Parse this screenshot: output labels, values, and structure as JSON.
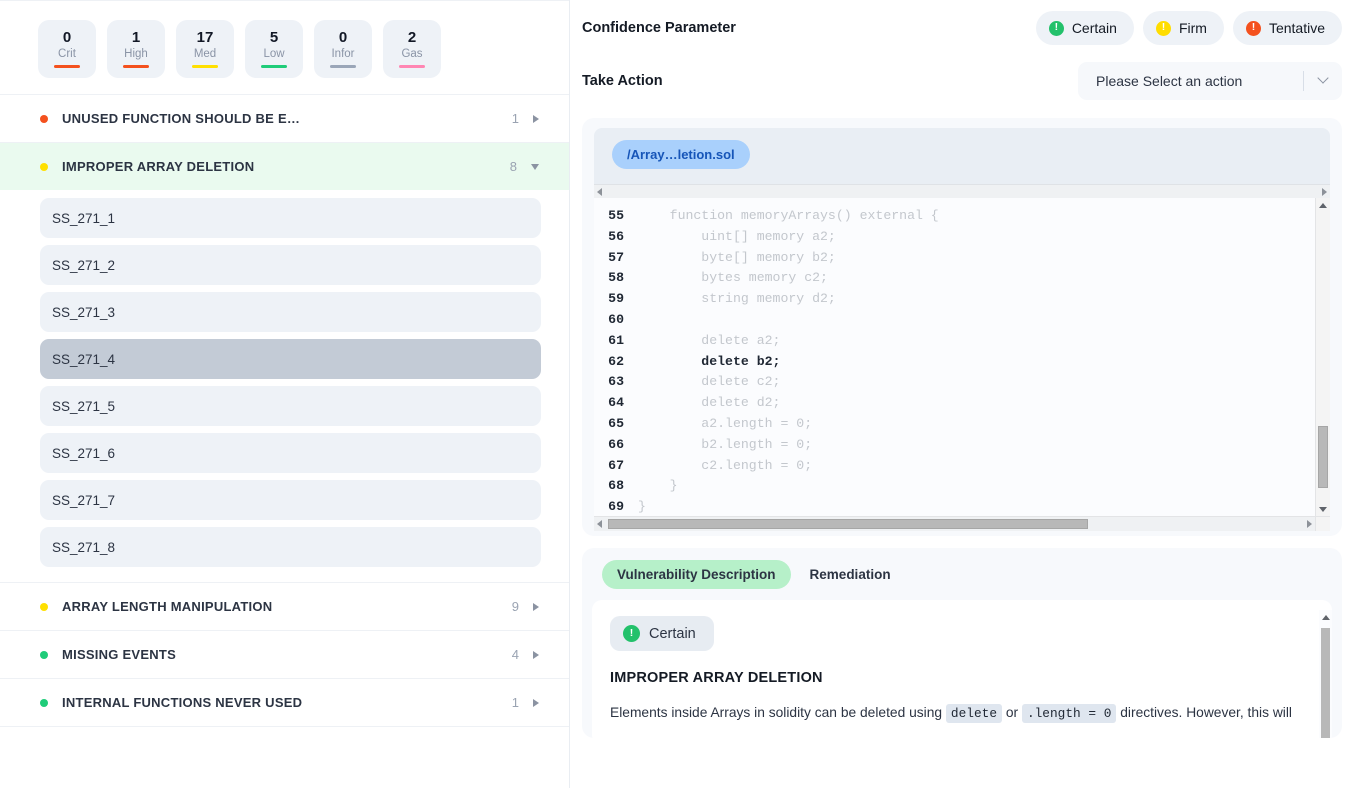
{
  "severity_cards": [
    {
      "count": "0",
      "label": "Crit",
      "color": "#f4511e"
    },
    {
      "count": "1",
      "label": "High",
      "color": "#f4511e"
    },
    {
      "count": "17",
      "label": "Med",
      "color": "#ffe000"
    },
    {
      "count": "5",
      "label": "Low",
      "color": "#1fcc79"
    },
    {
      "count": "0",
      "label": "Infor",
      "color": "#9aa6b8"
    },
    {
      "count": "2",
      "label": "Gas",
      "color": "#ff86b3"
    }
  ],
  "vuln_groups": [
    {
      "name": "UNUSED FUNCTION SHOULD BE E…",
      "count": "1",
      "dot": "#f4511e",
      "expanded": false
    },
    {
      "name": "IMPROPER ARRAY DELETION",
      "count": "8",
      "dot": "#ffe000",
      "expanded": true
    },
    {
      "name": "ARRAY LENGTH MANIPULATION",
      "count": "9",
      "dot": "#ffe000",
      "expanded": false
    },
    {
      "name": "MISSING EVENTS",
      "count": "4",
      "dot": "#1fcc79",
      "expanded": false
    },
    {
      "name": "INTERNAL FUNCTIONS NEVER USED",
      "count": "1",
      "dot": "#1fcc79",
      "expanded": false
    }
  ],
  "sub_items": [
    {
      "label": "SS_271_1",
      "selected": false
    },
    {
      "label": "SS_271_2",
      "selected": false
    },
    {
      "label": "SS_271_3",
      "selected": false
    },
    {
      "label": "SS_271_4",
      "selected": true
    },
    {
      "label": "SS_271_5",
      "selected": false
    },
    {
      "label": "SS_271_6",
      "selected": false
    },
    {
      "label": "SS_271_7",
      "selected": false
    },
    {
      "label": "SS_271_8",
      "selected": false
    }
  ],
  "confidence": {
    "label": "Confidence Parameter",
    "buttons": [
      {
        "label": "Certain",
        "color": "#23c16b"
      },
      {
        "label": "Firm",
        "color": "#ffdd00"
      },
      {
        "label": "Tentative",
        "color": "#f4511e"
      }
    ]
  },
  "take_action": {
    "label": "Take Action",
    "selected": "Please Select an action"
  },
  "code_panel": {
    "file_tab": "/Array…letion.sol",
    "lines": [
      {
        "num": "55",
        "text": "    function memoryArrays() external {",
        "highlight": false
      },
      {
        "num": "56",
        "text": "        uint[] memory a2;",
        "highlight": false
      },
      {
        "num": "57",
        "text": "        byte[] memory b2;",
        "highlight": false
      },
      {
        "num": "58",
        "text": "        bytes memory c2;",
        "highlight": false
      },
      {
        "num": "59",
        "text": "        string memory d2;",
        "highlight": false
      },
      {
        "num": "60",
        "text": "",
        "highlight": false
      },
      {
        "num": "61",
        "text": "        delete a2;",
        "highlight": false
      },
      {
        "num": "62",
        "text": "        delete b2;",
        "highlight": true
      },
      {
        "num": "63",
        "text": "        delete c2;",
        "highlight": false
      },
      {
        "num": "64",
        "text": "        delete d2;",
        "highlight": false
      },
      {
        "num": "65",
        "text": "        a2.length = 0;",
        "highlight": false
      },
      {
        "num": "66",
        "text": "        b2.length = 0;",
        "highlight": false
      },
      {
        "num": "67",
        "text": "        c2.length = 0;",
        "highlight": false
      },
      {
        "num": "68",
        "text": "    }",
        "highlight": false
      },
      {
        "num": "69",
        "text": "}",
        "highlight": false
      }
    ]
  },
  "description": {
    "tabs": [
      {
        "label": "Vulnerability Description",
        "active": true
      },
      {
        "label": "Remediation",
        "active": false
      }
    ],
    "badge": {
      "label": "Certain",
      "color": "#23c16b"
    },
    "title": "IMPROPER ARRAY DELETION",
    "text_part1": "Elements inside Arrays in solidity can be deleted using ",
    "code1": "delete",
    "text_part2": " or ",
    "code2": ".length = 0",
    "text_part3": " directives. However, this will"
  }
}
